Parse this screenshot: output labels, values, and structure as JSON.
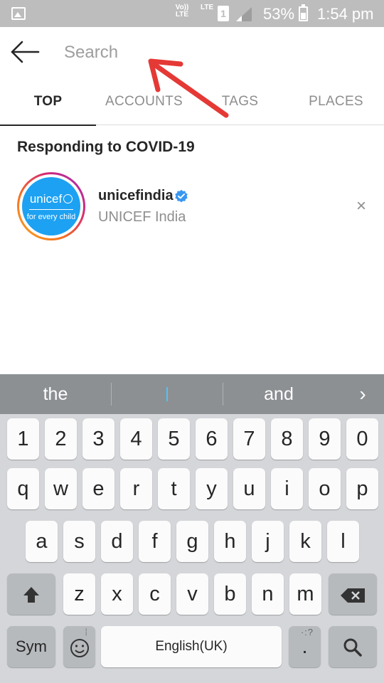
{
  "status_bar": {
    "network_label": "Vo)) LTE",
    "lte_label": "LTE",
    "sim_slot": "1",
    "battery_percent_text": "53%",
    "battery_level": 0.53,
    "time": "1:54 pm"
  },
  "search": {
    "placeholder": "Search",
    "value": ""
  },
  "tabs": [
    {
      "label": "TOP",
      "active": true
    },
    {
      "label": "ACCOUNTS",
      "active": false
    },
    {
      "label": "TAGS",
      "active": false
    },
    {
      "label": "PLACES",
      "active": false
    }
  ],
  "section": {
    "title": "Responding to COVID-19"
  },
  "account": {
    "username": "unicefindia",
    "full_name": "UNICEF India",
    "verified": true,
    "avatar_logo_text": "unicef",
    "avatar_tagline": "for every child",
    "remove_symbol": "×"
  },
  "keyboard": {
    "suggestions": [
      "the",
      "",
      "and"
    ],
    "next_symbol": "›",
    "rows": {
      "numbers": [
        "1",
        "2",
        "3",
        "4",
        "5",
        "6",
        "7",
        "8",
        "9",
        "0"
      ],
      "row1": [
        "q",
        "w",
        "e",
        "r",
        "t",
        "y",
        "u",
        "i",
        "o",
        "p"
      ],
      "row2": [
        "a",
        "s",
        "d",
        "f",
        "g",
        "h",
        "j",
        "k",
        "l"
      ],
      "row3": [
        "z",
        "x",
        "c",
        "v",
        "b",
        "n",
        "m"
      ]
    },
    "sym_label": "Sym",
    "space_label": "English(UK)",
    "period_label": ".",
    "period_sub": "·:?"
  },
  "colors": {
    "status_bar": "#bdbdbd",
    "accent_blue": "#1da1f2",
    "annotation_red": "#e53935",
    "keyboard_bg": "#d4d6d9",
    "suggestion_bar": "#8d9093"
  }
}
